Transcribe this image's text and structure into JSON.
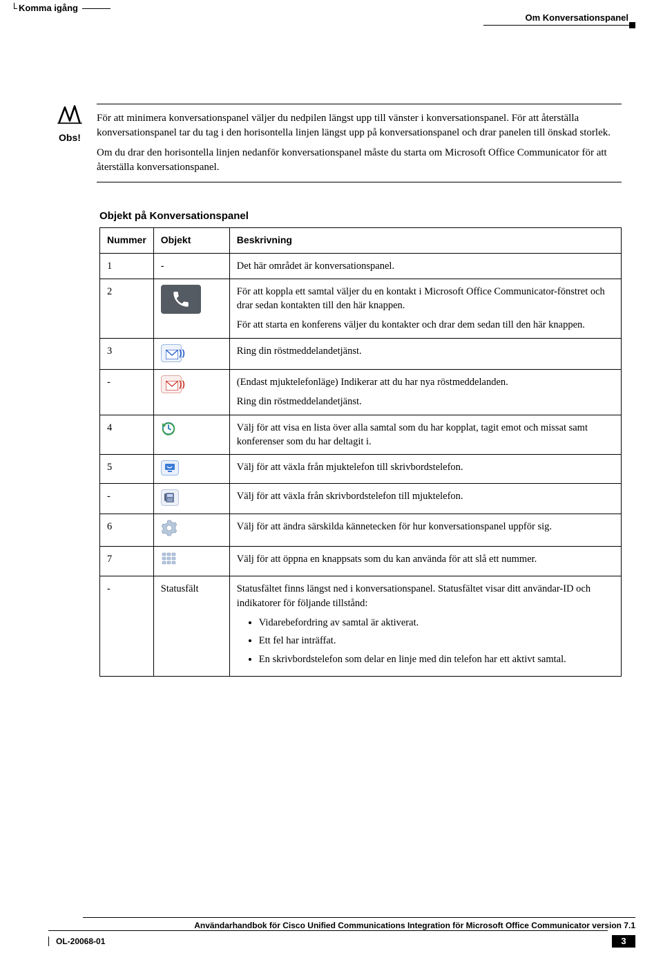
{
  "header": {
    "left": "Komma igång",
    "right": "Om Konversationspanel"
  },
  "note": {
    "label": "Obs!",
    "paragraphs": [
      "För att minimera konversationspanel väljer du nedpilen längst upp till vänster i konversationspanel. För att återställa konversationspanel tar du tag i den horisontella linjen längst upp på konversationspanel och drar panelen till önskad storlek.",
      "Om du drar den horisontella linjen nedanför konversationspanel måste du starta om Microsoft Office Communicator för att återställa konversationspanel."
    ]
  },
  "table": {
    "title": "Objekt på Konversationspanel",
    "headers": {
      "num": "Nummer",
      "obj": "Objekt",
      "desc": "Beskrivning"
    },
    "rows": [
      {
        "num": "1",
        "obj_text": "-",
        "icon": null,
        "desc_paragraphs": [
          "Det här området är konversationspanel."
        ]
      },
      {
        "num": "2",
        "icon": "phone-icon",
        "desc_paragraphs": [
          "För att koppla ett samtal väljer du en kontakt i Microsoft Office Communicator-fönstret och drar sedan kontakten till den här knappen.",
          "För att starta en konferens väljer du kontakter och drar dem sedan till den här knappen."
        ]
      },
      {
        "num": "3",
        "icon": "voicemail-icon",
        "desc_paragraphs": [
          "Ring din röstmeddelandetjänst."
        ]
      },
      {
        "num": "-",
        "icon": "voicemail-new-icon",
        "desc_paragraphs": [
          "(Endast mjuktelefonläge) Indikerar att du har nya röstmeddelanden.",
          "Ring din röstmeddelandetjänst."
        ]
      },
      {
        "num": "4",
        "icon": "history-icon",
        "desc_paragraphs": [
          "Välj för att visa en lista över alla samtal som du har kopplat, tagit emot och missat samt konferenser som du har deltagit i."
        ]
      },
      {
        "num": "5",
        "icon": "softphone-icon",
        "desc_paragraphs": [
          "Välj för att växla från mjuktelefon till skrivbordstelefon."
        ]
      },
      {
        "num": "-",
        "icon": "deskphone-icon",
        "desc_paragraphs": [
          "Välj för att växla från skrivbordstelefon till mjuktelefon."
        ]
      },
      {
        "num": "6",
        "icon": "gear-icon",
        "desc_paragraphs": [
          "Välj för att ändra särskilda kännetecken för hur konversationspanel uppför sig."
        ]
      },
      {
        "num": "7",
        "icon": "dialpad-icon",
        "desc_paragraphs": [
          "Välj för att öppna en knappsats som du kan använda för att slå ett nummer."
        ]
      },
      {
        "num": "-",
        "obj_text": "Statusfält",
        "icon": null,
        "desc_paragraphs": [
          "Statusfältet finns längst ned i konversationspanel. Statusfältet visar ditt användar-ID och indikatorer för följande tillstånd:"
        ],
        "desc_bullets": [
          "Vidarebefordring av samtal är aktiverat.",
          "Ett fel har inträffat.",
          "En skrivbordstelefon som delar en linje med din telefon har ett aktivt samtal."
        ]
      }
    ]
  },
  "footer": {
    "manual": "Användarhandbok för Cisco Unified Communications Integration för Microsoft Office Communicator version 7.1",
    "code": "OL-20068-01",
    "page": "3"
  }
}
